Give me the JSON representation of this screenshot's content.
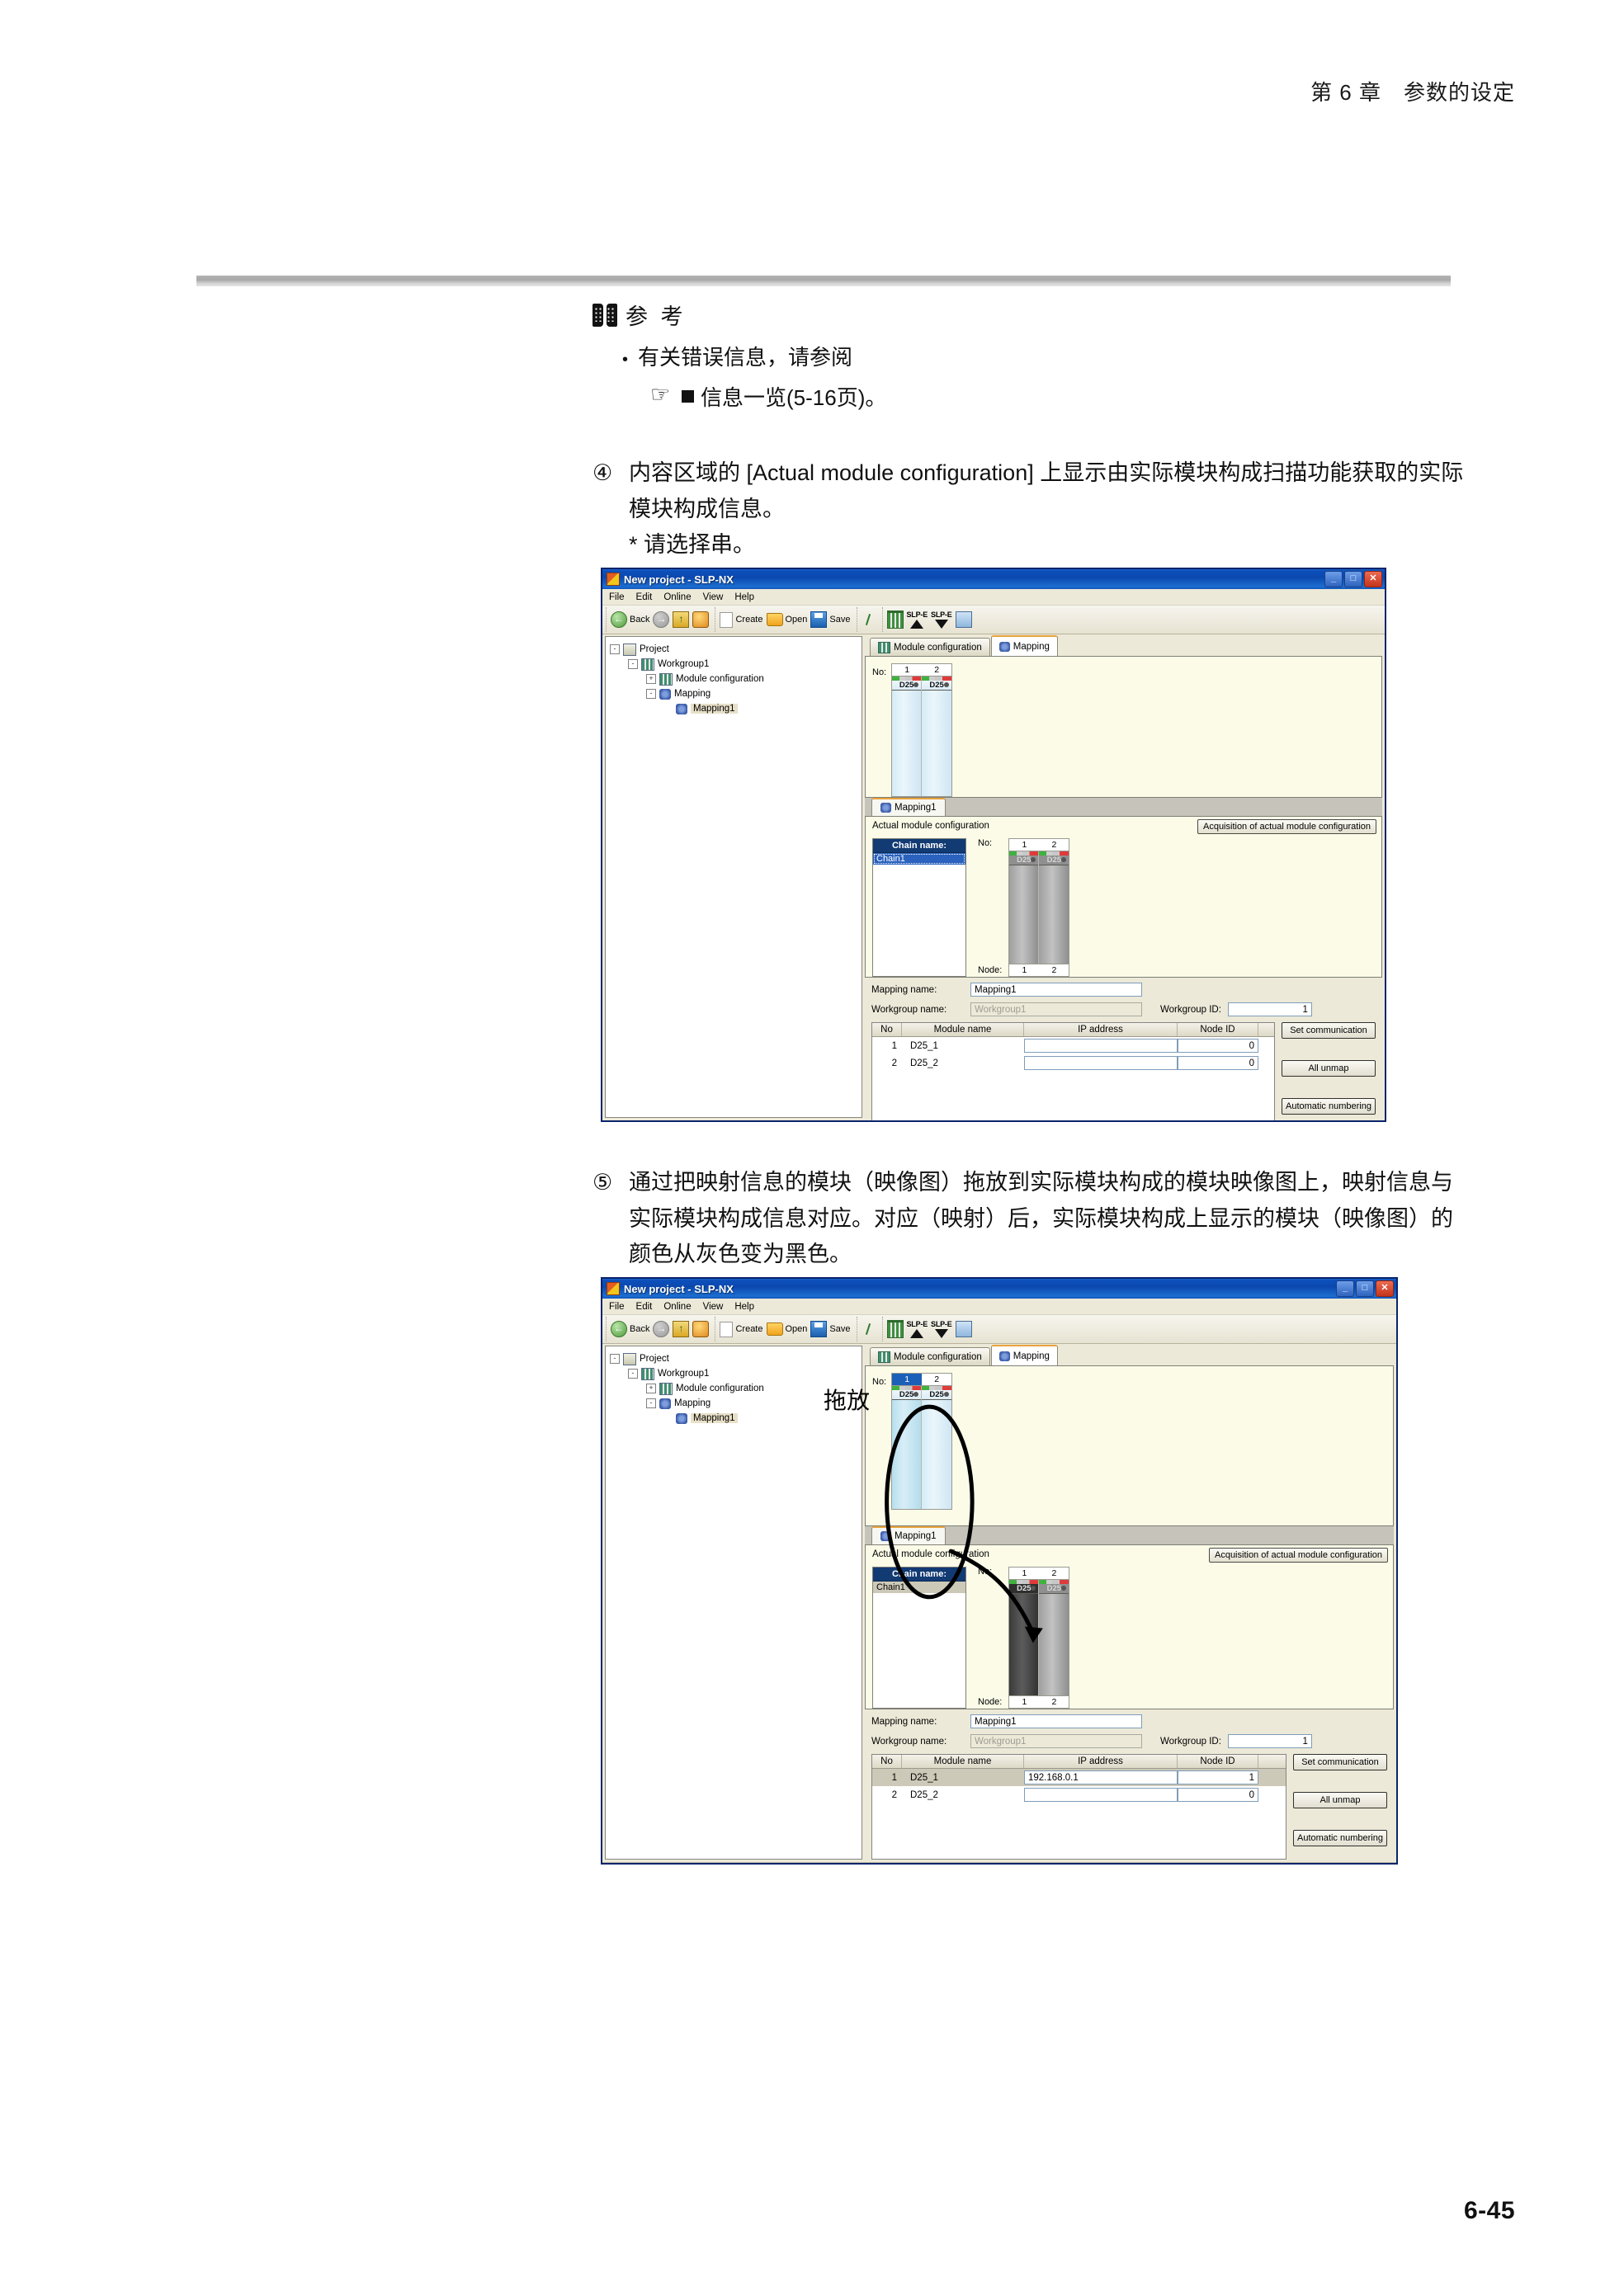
{
  "page": {
    "header": "第 6 章　参数的设定",
    "footer": "6-45"
  },
  "note": {
    "icon": "book-icon",
    "title": "参 考",
    "bullet_symbol": "•",
    "bullet_text": "有关错误信息，请参阅",
    "ref_icon": "pointing-hand-icon",
    "ref_text": "信息一览(5-16页)。"
  },
  "steps": [
    {
      "number": "④",
      "text": "内容区域的 [Actual module configuration] 上显示由实际模块构成扫描功能获取的实际模块构成信息。",
      "note": "* 请选择串。"
    },
    {
      "number": "⑤",
      "text": "通过把映射信息的模块（映像图）拖放到实际模块构成的模块映像图上，映射信息与实际模块构成信息对应。对应（映射）后，实际模块构成上显示的模块（映像图）的颜色从灰色变为黑色。"
    }
  ],
  "app": {
    "title": "New project - SLP-NX",
    "window_buttons": {
      "minimize": "_",
      "maximize": "□",
      "close": "✕"
    },
    "menu": [
      "File",
      "Edit",
      "Online",
      "View",
      "Help"
    ],
    "toolbar": {
      "back": "Back",
      "forward": "forward-icon",
      "up": "up-one-level-icon",
      "home": "home-icon",
      "create": "Create",
      "open": "Open",
      "save": "Save",
      "edit_tool": "pen-icon",
      "rack": "rack-icon",
      "slpe_up_label": "SLP-E",
      "slpe_down_label": "SLP-E",
      "monitor": "monitor-icon"
    },
    "tree": [
      {
        "label": "Project",
        "expander": "-",
        "icon": "project-icon",
        "depth": 0,
        "selected": false
      },
      {
        "label": "Workgroup1",
        "expander": "-",
        "icon": "workgroup-icon",
        "depth": 1,
        "selected": false
      },
      {
        "label": "Module configuration",
        "expander": "+",
        "icon": "module-config-icon",
        "depth": 2,
        "selected": false
      },
      {
        "label": "Mapping",
        "expander": "-",
        "icon": "mapping-icon",
        "depth": 2,
        "selected": false
      },
      {
        "label": "Mapping1",
        "expander": "",
        "icon": "mapping-icon",
        "depth": 3,
        "selected": true
      }
    ],
    "tabs": [
      {
        "label": "Module configuration",
        "icon": "module-config-icon",
        "active": false
      },
      {
        "label": "Mapping",
        "icon": "mapping-icon",
        "active": true
      }
    ],
    "sub_tab": {
      "label": "Mapping1",
      "icon": "mapping-icon"
    },
    "mapping_rack": {
      "no_label": "No:",
      "columns": [
        "1",
        "2"
      ],
      "modules": [
        {
          "name": "D25",
          "style": "blue"
        },
        {
          "name": "D25",
          "style": "blue"
        }
      ]
    },
    "actual": {
      "heading": "Actual module configuration",
      "acquire_button": "Acquisition of actual module configuration",
      "chain_header": "Chain name:",
      "chains": [
        "Chain1"
      ],
      "no_label": "No:",
      "node_label": "Node:",
      "columns": [
        "1",
        "2"
      ],
      "nodes": [
        "1",
        "2"
      ],
      "modules": [
        {
          "name": "D25",
          "style": "gray"
        },
        {
          "name": "D25",
          "style": "gray"
        }
      ]
    },
    "form": {
      "mapping_name_label": "Mapping name:",
      "mapping_name_value": "Mapping1",
      "workgroup_name_label": "Workgroup name:",
      "workgroup_name_value": "Workgroup1",
      "workgroup_id_label": "Workgroup ID:",
      "workgroup_id_value": "1"
    },
    "grid": {
      "headers": [
        "No",
        "Module name",
        "IP address",
        "Node ID",
        ""
      ],
      "rows": [
        {
          "no": "1",
          "module": "D25_1",
          "ip": "",
          "node": "0",
          "highlight": false
        },
        {
          "no": "2",
          "module": "D25_2",
          "ip": "",
          "node": "0",
          "highlight": false
        }
      ]
    },
    "buttons": {
      "set_communication": "Set communication",
      "all_unmap": "All unmap",
      "automatic_numbering": "Automatic numbering"
    }
  },
  "app2": {
    "title": "New project - SLP-NX",
    "annotation_label": "拖放",
    "annotation_shapes": [
      "ellipse-around-module-1",
      "drag-arrow"
    ],
    "mapping_rack": {
      "no_label": "No:",
      "columns": [
        "1",
        "2"
      ],
      "selected_column": "1",
      "modules": [
        {
          "name": "D25",
          "style": "blue",
          "selected": true
        },
        {
          "name": "D25",
          "style": "blue",
          "selected": false
        }
      ]
    },
    "actual": {
      "heading": "Actual module configuration",
      "acquire_button": "Acquisition of actual module configuration",
      "chain_header": "Chain name:",
      "chains": [
        "Chain1"
      ],
      "no_label": "No:",
      "node_label": "Node:",
      "columns": [
        "1",
        "2"
      ],
      "nodes": [
        "1",
        "2"
      ],
      "modules": [
        {
          "name": "D25",
          "style": "dark"
        },
        {
          "name": "D25",
          "style": "gray"
        }
      ]
    },
    "form": {
      "mapping_name_label": "Mapping name:",
      "mapping_name_value": "Mapping1",
      "workgroup_name_label": "Workgroup name:",
      "workgroup_name_value": "Workgroup1",
      "workgroup_id_label": "Workgroup ID:",
      "workgroup_id_value": "1"
    },
    "grid": {
      "headers": [
        "No",
        "Module name",
        "IP address",
        "Node ID",
        ""
      ],
      "rows": [
        {
          "no": "1",
          "module": "D25_1",
          "ip": "192.168.0.1",
          "node": "1",
          "highlight": true
        },
        {
          "no": "2",
          "module": "D25_2",
          "ip": "",
          "node": "0",
          "highlight": false
        }
      ]
    }
  },
  "colors": {
    "titlebar_blue": "#0b48ae",
    "window_chrome": "#ece9d8",
    "canvas_cream": "#fbfbe8",
    "tab_accent": "#e8a33d",
    "chain_header": "#123a73",
    "selection_blue": "#2a62bd"
  }
}
